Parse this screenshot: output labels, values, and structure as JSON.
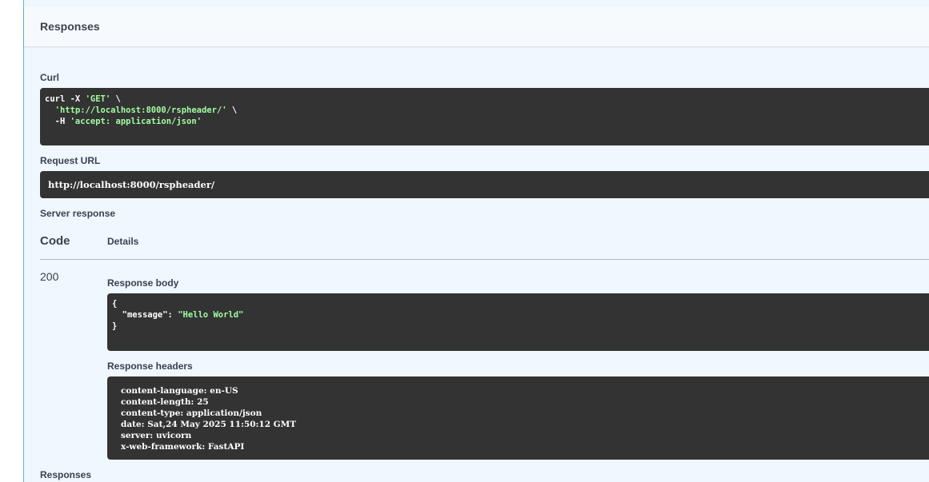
{
  "responses_section": {
    "title": "Responses"
  },
  "curl": {
    "label": "Curl",
    "lines": [
      {
        "prefix": "curl -X ",
        "string": "'GET'",
        "suffix": " \\"
      },
      {
        "prefix": "  ",
        "string": "'http://localhost:8000/rspheader/'",
        "suffix": " \\"
      },
      {
        "prefix": "  -H ",
        "string": "'accept: application/json'",
        "suffix": ""
      }
    ]
  },
  "request_url": {
    "label": "Request URL",
    "value": "http://localhost:8000/rspheader/"
  },
  "server_response": {
    "label": "Server response",
    "col_code": "Code",
    "col_details": "Details",
    "status_code": "200",
    "body_label": "Response body",
    "body_lines": [
      {
        "prefix": "{",
        "key": "",
        "string": ""
      },
      {
        "prefix": "  ",
        "key": "\"message\": ",
        "string": "\"Hello World\""
      },
      {
        "prefix": "}",
        "key": "",
        "string": ""
      }
    ],
    "headers_label": "Response headers",
    "headers_lines": [
      "content-language: en-US",
      "content-length: 25",
      "content-type: application/json",
      "date: Sat,24 May 2025 11:50:12 GMT",
      "server: uvicorn",
      "x-web-framework: FastAPI"
    ]
  },
  "footer_section": {
    "title": "Responses"
  },
  "colors": {
    "accent": "#61affe",
    "panel_bg": "#eff7ff",
    "code_bg": "#333333",
    "string_green": "#a2fca2"
  }
}
